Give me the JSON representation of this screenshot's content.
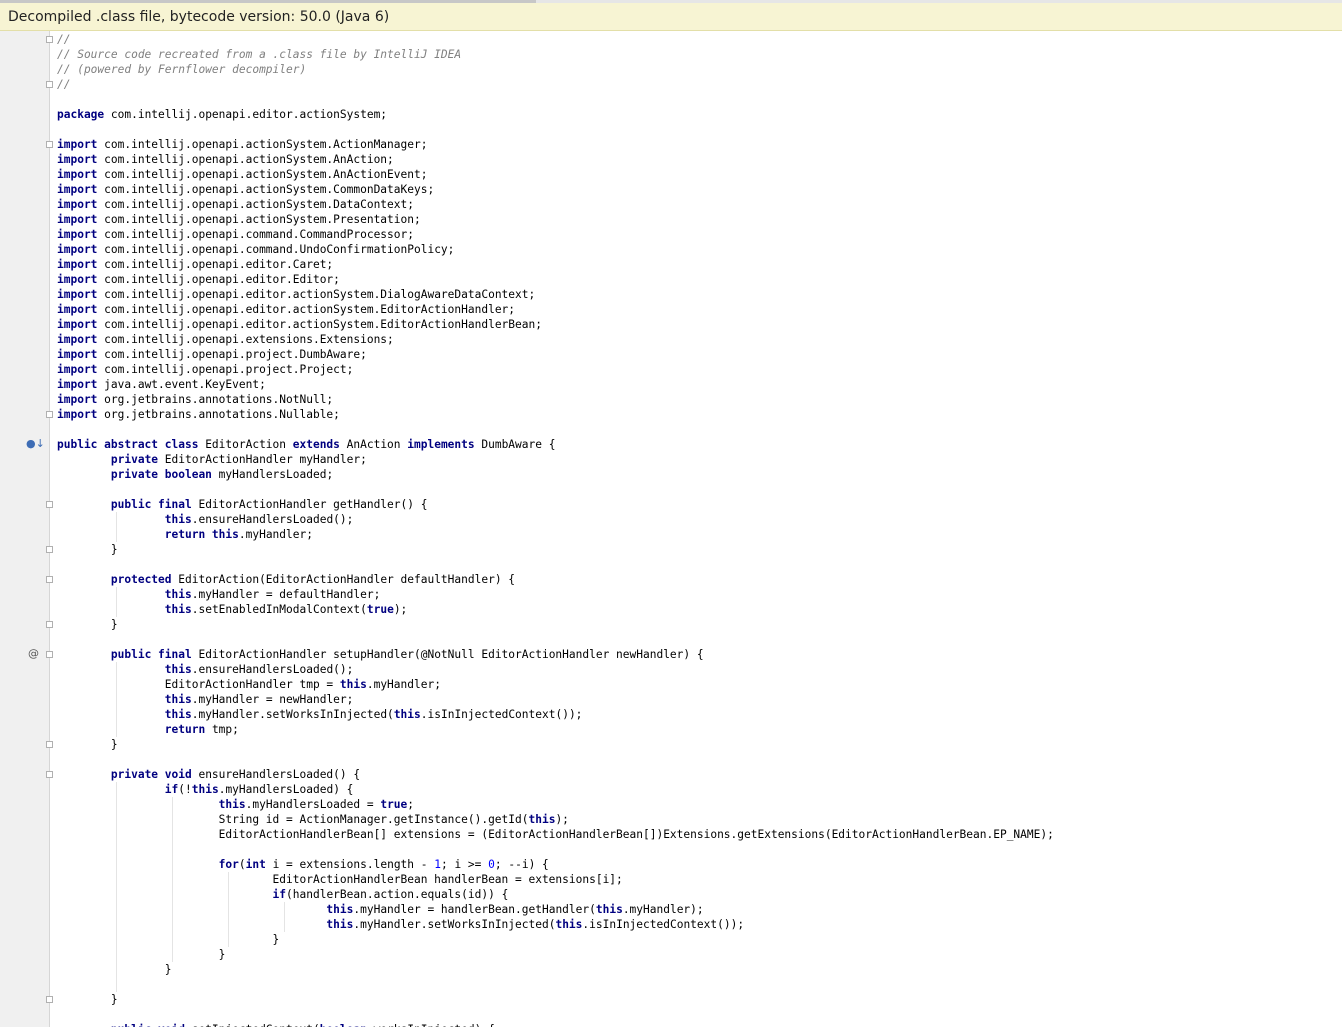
{
  "banner": {
    "text": "Decompiled .class file, bytecode version: 50.0 (Java 6)"
  },
  "gutter": {
    "override_icon": "override-implements-icon",
    "annotation_icon": "at-annotation-icon",
    "annotation_symbol": "@",
    "override_symbol": "●↓"
  },
  "colors": {
    "keyword": "#000080",
    "comment": "#808080",
    "number": "#0000ff",
    "banner_bg": "#f7f4d3",
    "gutter_bg": "#f0f0f0"
  },
  "code": [
    [
      [
        "cm",
        "//"
      ]
    ],
    [
      [
        "cm",
        "// Source code recreated from a .class file by IntelliJ IDEA"
      ]
    ],
    [
      [
        "cm",
        "// (powered by Fernflower decompiler)"
      ]
    ],
    [
      [
        "cm",
        "//"
      ]
    ],
    [],
    [
      [
        "kw",
        "package"
      ],
      [
        "t",
        " com.intellij.openapi.editor.actionSystem;"
      ]
    ],
    [],
    [
      [
        "kw",
        "import"
      ],
      [
        "t",
        " com.intellij.openapi.actionSystem.ActionManager;"
      ]
    ],
    [
      [
        "kw",
        "import"
      ],
      [
        "t",
        " com.intellij.openapi.actionSystem.AnAction;"
      ]
    ],
    [
      [
        "kw",
        "import"
      ],
      [
        "t",
        " com.intellij.openapi.actionSystem.AnActionEvent;"
      ]
    ],
    [
      [
        "kw",
        "import"
      ],
      [
        "t",
        " com.intellij.openapi.actionSystem.CommonDataKeys;"
      ]
    ],
    [
      [
        "kw",
        "import"
      ],
      [
        "t",
        " com.intellij.openapi.actionSystem.DataContext;"
      ]
    ],
    [
      [
        "kw",
        "import"
      ],
      [
        "t",
        " com.intellij.openapi.actionSystem.Presentation;"
      ]
    ],
    [
      [
        "kw",
        "import"
      ],
      [
        "t",
        " com.intellij.openapi.command.CommandProcessor;"
      ]
    ],
    [
      [
        "kw",
        "import"
      ],
      [
        "t",
        " com.intellij.openapi.command.UndoConfirmationPolicy;"
      ]
    ],
    [
      [
        "kw",
        "import"
      ],
      [
        "t",
        " com.intellij.openapi.editor.Caret;"
      ]
    ],
    [
      [
        "kw",
        "import"
      ],
      [
        "t",
        " com.intellij.openapi.editor.Editor;"
      ]
    ],
    [
      [
        "kw",
        "import"
      ],
      [
        "t",
        " com.intellij.openapi.editor.actionSystem.DialogAwareDataContext;"
      ]
    ],
    [
      [
        "kw",
        "import"
      ],
      [
        "t",
        " com.intellij.openapi.editor.actionSystem.EditorActionHandler;"
      ]
    ],
    [
      [
        "kw",
        "import"
      ],
      [
        "t",
        " com.intellij.openapi.editor.actionSystem.EditorActionHandlerBean;"
      ]
    ],
    [
      [
        "kw",
        "import"
      ],
      [
        "t",
        " com.intellij.openapi.extensions.Extensions;"
      ]
    ],
    [
      [
        "kw",
        "import"
      ],
      [
        "t",
        " com.intellij.openapi.project.DumbAware;"
      ]
    ],
    [
      [
        "kw",
        "import"
      ],
      [
        "t",
        " com.intellij.openapi.project.Project;"
      ]
    ],
    [
      [
        "kw",
        "import"
      ],
      [
        "t",
        " java.awt.event.KeyEvent;"
      ]
    ],
    [
      [
        "kw",
        "import"
      ],
      [
        "t",
        " org.jetbrains.annotations.NotNull;"
      ]
    ],
    [
      [
        "kw",
        "import"
      ],
      [
        "t",
        " org.jetbrains.annotations.Nullable;"
      ]
    ],
    [],
    [
      [
        "kw",
        "public abstract class"
      ],
      [
        "t",
        " EditorAction "
      ],
      [
        "kw",
        "extends"
      ],
      [
        "t",
        " AnAction "
      ],
      [
        "kw",
        "implements"
      ],
      [
        "t",
        " DumbAware {"
      ]
    ],
    [
      [
        "t",
        "        "
      ],
      [
        "kw",
        "private"
      ],
      [
        "t",
        " EditorActionHandler myHandler;"
      ]
    ],
    [
      [
        "t",
        "        "
      ],
      [
        "kw",
        "private boolean"
      ],
      [
        "t",
        " myHandlersLoaded;"
      ]
    ],
    [],
    [
      [
        "t",
        "        "
      ],
      [
        "kw",
        "public final"
      ],
      [
        "t",
        " EditorActionHandler getHandler() {"
      ]
    ],
    [
      [
        "t",
        "                "
      ],
      [
        "kw",
        "this"
      ],
      [
        "t",
        ".ensureHandlersLoaded();"
      ]
    ],
    [
      [
        "t",
        "                "
      ],
      [
        "kw",
        "return this"
      ],
      [
        "t",
        ".myHandler;"
      ]
    ],
    [
      [
        "t",
        "        }"
      ]
    ],
    [],
    [
      [
        "t",
        "        "
      ],
      [
        "kw",
        "protected"
      ],
      [
        "t",
        " EditorAction(EditorActionHandler defaultHandler) {"
      ]
    ],
    [
      [
        "t",
        "                "
      ],
      [
        "kw",
        "this"
      ],
      [
        "t",
        ".myHandler = defaultHandler;"
      ]
    ],
    [
      [
        "t",
        "                "
      ],
      [
        "kw",
        "this"
      ],
      [
        "t",
        ".setEnabledInModalContext("
      ],
      [
        "kw",
        "true"
      ],
      [
        "t",
        ");"
      ]
    ],
    [
      [
        "t",
        "        }"
      ]
    ],
    [],
    [
      [
        "t",
        "        "
      ],
      [
        "kw",
        "public final"
      ],
      [
        "t",
        " EditorActionHandler setupHandler(@NotNull EditorActionHandler newHandler) {"
      ]
    ],
    [
      [
        "t",
        "                "
      ],
      [
        "kw",
        "this"
      ],
      [
        "t",
        ".ensureHandlersLoaded();"
      ]
    ],
    [
      [
        "t",
        "                EditorActionHandler tmp = "
      ],
      [
        "kw",
        "this"
      ],
      [
        "t",
        ".myHandler;"
      ]
    ],
    [
      [
        "t",
        "                "
      ],
      [
        "kw",
        "this"
      ],
      [
        "t",
        ".myHandler = newHandler;"
      ]
    ],
    [
      [
        "t",
        "                "
      ],
      [
        "kw",
        "this"
      ],
      [
        "t",
        ".myHandler.setWorksInInjected("
      ],
      [
        "kw",
        "this"
      ],
      [
        "t",
        ".isInInjectedContext());"
      ]
    ],
    [
      [
        "t",
        "                "
      ],
      [
        "kw",
        "return"
      ],
      [
        "t",
        " tmp;"
      ]
    ],
    [
      [
        "t",
        "        }"
      ]
    ],
    [],
    [
      [
        "t",
        "        "
      ],
      [
        "kw",
        "private void"
      ],
      [
        "t",
        " ensureHandlersLoaded() {"
      ]
    ],
    [
      [
        "t",
        "                "
      ],
      [
        "kw",
        "if"
      ],
      [
        "t",
        "(!"
      ],
      [
        "kw",
        "this"
      ],
      [
        "t",
        ".myHandlersLoaded) {"
      ]
    ],
    [
      [
        "t",
        "                        "
      ],
      [
        "kw",
        "this"
      ],
      [
        "t",
        ".myHandlersLoaded = "
      ],
      [
        "kw",
        "true"
      ],
      [
        "t",
        ";"
      ]
    ],
    [
      [
        "t",
        "                        String id = ActionManager.getInstance().getId("
      ],
      [
        "kw",
        "this"
      ],
      [
        "t",
        ");"
      ]
    ],
    [
      [
        "t",
        "                        EditorActionHandlerBean[] extensions = (EditorActionHandlerBean[])Extensions.getExtensions(EditorActionHandlerBean.EP_NAME);"
      ]
    ],
    [],
    [
      [
        "t",
        "                        "
      ],
      [
        "kw",
        "for"
      ],
      [
        "t",
        "("
      ],
      [
        "kw",
        "int"
      ],
      [
        "t",
        " i = extensions.length - "
      ],
      [
        "num",
        "1"
      ],
      [
        "t",
        "; i >= "
      ],
      [
        "num",
        "0"
      ],
      [
        "t",
        "; --i) {"
      ]
    ],
    [
      [
        "t",
        "                                EditorActionHandlerBean handlerBean = extensions[i];"
      ]
    ],
    [
      [
        "t",
        "                                "
      ],
      [
        "kw",
        "if"
      ],
      [
        "t",
        "(handlerBean.action.equals(id)) {"
      ]
    ],
    [
      [
        "t",
        "                                        "
      ],
      [
        "kw",
        "this"
      ],
      [
        "t",
        ".myHandler = handlerBean.getHandler("
      ],
      [
        "kw",
        "this"
      ],
      [
        "t",
        ".myHandler);"
      ]
    ],
    [
      [
        "t",
        "                                        "
      ],
      [
        "kw",
        "this"
      ],
      [
        "t",
        ".myHandler.setWorksInInjected("
      ],
      [
        "kw",
        "this"
      ],
      [
        "t",
        ".isInInjectedContext());"
      ]
    ],
    [
      [
        "t",
        "                                }"
      ]
    ],
    [
      [
        "t",
        "                        }"
      ]
    ],
    [
      [
        "t",
        "                }"
      ]
    ],
    [],
    [
      [
        "t",
        "        }"
      ]
    ],
    [],
    [
      [
        "t",
        "        "
      ],
      [
        "kw",
        "public void"
      ],
      [
        "t",
        " setInjectedContext("
      ],
      [
        "kw",
        "boolean"
      ],
      [
        "t",
        " worksInInjected) {"
      ]
    ]
  ]
}
